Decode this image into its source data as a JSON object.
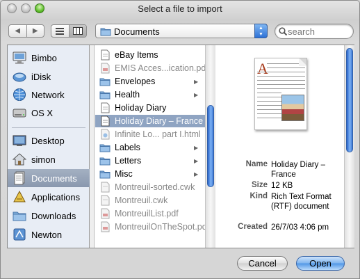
{
  "window": {
    "title": "Select a file to import"
  },
  "toolbar": {
    "back_glyph": "◀",
    "forward_glyph": "▶",
    "location": "Documents",
    "search_placeholder": "search"
  },
  "sidebar": {
    "devices": [
      {
        "label": "Bimbo",
        "icon": "computer-icon"
      },
      {
        "label": "iDisk",
        "icon": "idisk-icon"
      },
      {
        "label": "Network",
        "icon": "network-globe-icon"
      },
      {
        "label": "OS X",
        "icon": "hard-drive-icon"
      }
    ],
    "places": [
      {
        "label": "Desktop",
        "icon": "desktop-icon"
      },
      {
        "label": "simon",
        "icon": "home-icon"
      },
      {
        "label": "Documents",
        "icon": "documents-icon",
        "selected": true
      },
      {
        "label": "Applications",
        "icon": "applications-icon"
      },
      {
        "label": "Downloads",
        "icon": "downloads-folder-icon"
      },
      {
        "label": "Newton",
        "icon": "newton-icon"
      }
    ]
  },
  "files": [
    {
      "name": "eBay Items",
      "type": "doc",
      "arrow": false,
      "dim": false
    },
    {
      "name": "EMIS Acces...ication.pdf",
      "type": "pdf",
      "arrow": false,
      "dim": true
    },
    {
      "name": "Envelopes",
      "type": "folder",
      "arrow": true,
      "dim": false
    },
    {
      "name": "Health",
      "type": "folder",
      "arrow": true,
      "dim": false
    },
    {
      "name": "Holiday Diary",
      "type": "doc",
      "arrow": false,
      "dim": false
    },
    {
      "name": "Holiday Diary – France",
      "type": "doc",
      "arrow": false,
      "dim": false,
      "selected": true
    },
    {
      "name": "Infinite Lo... part I.html",
      "type": "html",
      "arrow": false,
      "dim": true
    },
    {
      "name": "Labels",
      "type": "folder",
      "arrow": true,
      "dim": false
    },
    {
      "name": "Letters",
      "type": "folder",
      "arrow": true,
      "dim": false
    },
    {
      "name": "Misc",
      "type": "folder",
      "arrow": true,
      "dim": false
    },
    {
      "name": "Montreuil-sorted.cwk",
      "type": "cwk",
      "arrow": false,
      "dim": true
    },
    {
      "name": "Montreuil.cwk",
      "type": "cwk",
      "arrow": false,
      "dim": true
    },
    {
      "name": "MontreuilList.pdf",
      "type": "pdf",
      "arrow": false,
      "dim": true
    },
    {
      "name": "MontreuilOnTheSpot.pdf",
      "type": "pdf",
      "arrow": false,
      "dim": true
    }
  ],
  "preview": {
    "name_key": "Name",
    "name_value": "Holiday Diary – France",
    "size_key": "Size",
    "size_value": "12 KB",
    "kind_key": "Kind",
    "kind_value": "Rich Text Format (RTF) document",
    "created_key": "Created",
    "created_value": "26/7/03 4:06 pm"
  },
  "buttons": {
    "cancel": "Cancel",
    "open": "Open"
  }
}
